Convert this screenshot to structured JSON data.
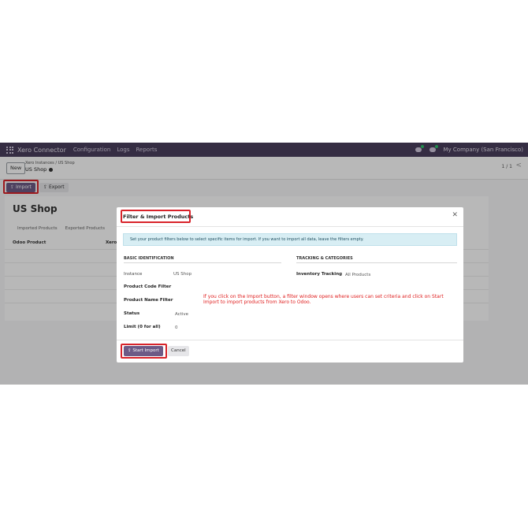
{
  "navbar": {
    "app_name": "Xero Connector",
    "menu": [
      "Configuration",
      "Logs",
      "Reports"
    ],
    "company": "My Company (San Francisco)"
  },
  "control": {
    "new_label": "New",
    "breadcrumb_parent": "Xero Instances",
    "breadcrumb_sep": "/",
    "breadcrumb_current": "US Shop",
    "breadcrumb_current_line2": "US Shop",
    "pager": "1 / 1",
    "pager_prev": "<"
  },
  "toolbar": {
    "import_label": "Import",
    "export_label": "Export"
  },
  "record": {
    "title": "US Shop",
    "tabs": [
      "Imported Products",
      "Exported Products"
    ],
    "col_product": "Odoo Product",
    "col_xero": "Xero"
  },
  "modal": {
    "title": "Filter & Import Products",
    "close": "✕",
    "info": "Set your product filters below to select specific items for import. If you want to import all data, leave the filters empty.",
    "section_left": "BASIC IDENTIFICATION",
    "section_right": "TRACKING & CATEGORIES",
    "fields": {
      "instance_label": "Instance",
      "instance_value": "US Shop",
      "code_filter_label": "Product Code Filter",
      "name_filter_label": "Product Name Filter",
      "status_label": "Status",
      "status_value": "Active",
      "limit_label": "Limit (0 for all)",
      "limit_value": "0",
      "tracking_label": "Inventory Tracking",
      "tracking_value": "All Products"
    },
    "note": "If you click on the Import button, a filter window opens where users can set criteria and click on Start Import to import products from Xero to Odoo.",
    "start_label": "Start Import",
    "cancel_label": "Cancel"
  },
  "colors": {
    "navbar": "#4a3f5e",
    "primary": "#6d5a86",
    "highlight": "#d8232a",
    "note": "#e02020"
  },
  "icons": [
    "apps-grid-icon",
    "chat-icon",
    "activity-icon",
    "gear-icon",
    "upload-icon",
    "download-icon",
    "close-icon",
    "chevron-left-icon"
  ]
}
